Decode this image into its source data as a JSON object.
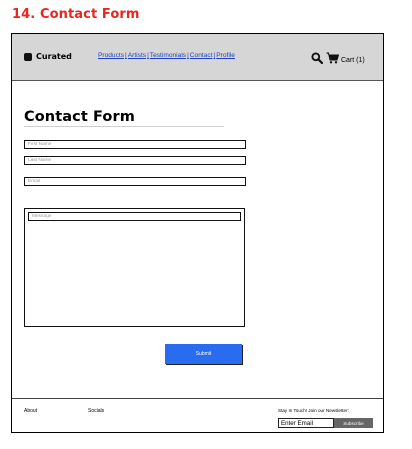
{
  "caption": "14. Contact Form",
  "header": {
    "logo_text": "Curated",
    "nav": [
      {
        "label": "Products"
      },
      {
        "label": "Artists"
      },
      {
        "label": "Testimonials"
      },
      {
        "label": "Contact"
      },
      {
        "label": "Profile"
      }
    ],
    "nav_separator": "|",
    "cart_label": "Cart (1)",
    "search_icon": "search-icon",
    "cart_icon": "cart-icon"
  },
  "form": {
    "title": "Contact Form",
    "first_name_placeholder": "First Name",
    "last_name_placeholder": "Last Name",
    "email_placeholder": "Email",
    "message_placeholder": "Message",
    "submit_label": "Submit"
  },
  "footer": {
    "about_label": "About",
    "socials_label": "Socials",
    "newsletter_label": "Stay In Touch! Join our Newsletter:",
    "email_placeholder": "Enter Email",
    "subscribe_label": "Subscribe"
  },
  "colors": {
    "caption": "#e8261c",
    "header_bg": "#d6d6d6",
    "nav_link": "#1f3fc4",
    "submit_bg": "#2a6cf0",
    "subscribe_bg": "#666666"
  }
}
